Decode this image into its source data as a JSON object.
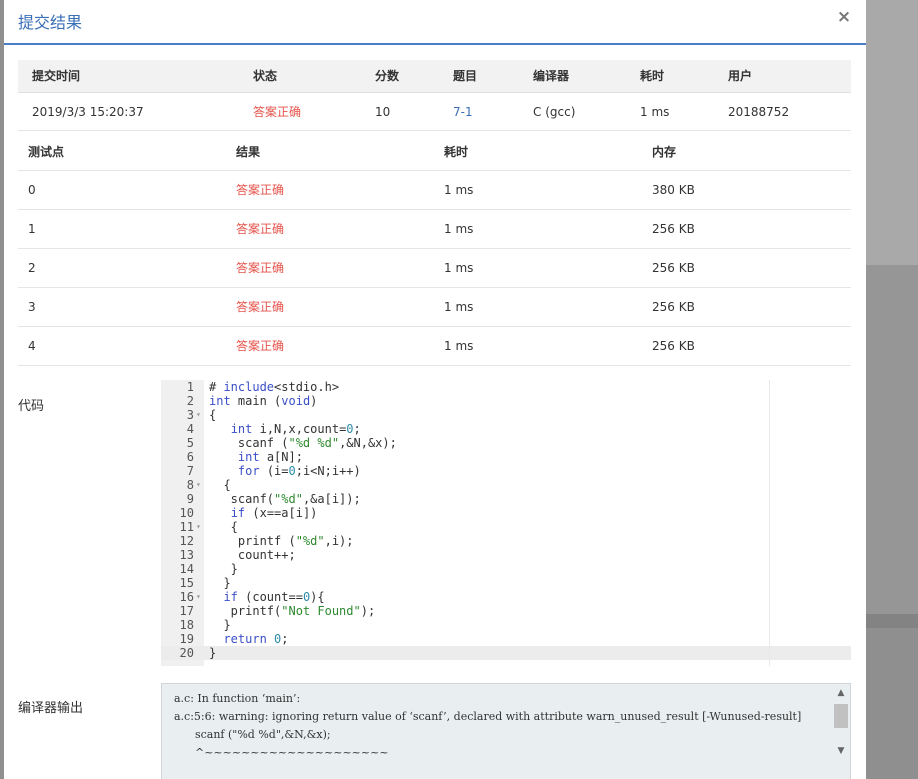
{
  "modal": {
    "title": "提交结果",
    "close_icon": "×"
  },
  "summary": {
    "headers": [
      "提交时间",
      "状态",
      "分数",
      "题目",
      "编译器",
      "耗时",
      "用户"
    ],
    "row": {
      "time": "2019/3/3 15:20:37",
      "status": "答案正确",
      "score": "10",
      "problem": "7-1",
      "compiler": "C (gcc)",
      "elapsed": "1 ms",
      "user": "20188752"
    }
  },
  "tests": {
    "headers": [
      "测试点",
      "结果",
      "耗时",
      "内存"
    ],
    "rows": [
      {
        "id": "0",
        "result": "答案正确",
        "time": "1 ms",
        "memory": "380 KB"
      },
      {
        "id": "1",
        "result": "答案正确",
        "time": "1 ms",
        "memory": "256 KB"
      },
      {
        "id": "2",
        "result": "答案正确",
        "time": "1 ms",
        "memory": "256 KB"
      },
      {
        "id": "3",
        "result": "答案正确",
        "time": "1 ms",
        "memory": "256 KB"
      },
      {
        "id": "4",
        "result": "答案正确",
        "time": "1 ms",
        "memory": "256 KB"
      }
    ]
  },
  "code": {
    "label": "代码",
    "lines": [
      "# include<stdio.h>",
      "int main (void)",
      "{",
      "   int i,N,x,count=0;",
      "    scanf (\"%d %d\",&N,&x);",
      "    int a[N];",
      "    for (i=0;i<N;i++)",
      "  {",
      "   scanf(\"%d\",&a[i]);",
      "   if (x==a[i])",
      "   {",
      "    printf (\"%d\",i);",
      "    count++;",
      "   }",
      "  }",
      "  if (count==0){",
      "   printf(\"Not Found\");",
      "  }",
      "  return 0;",
      "}"
    ],
    "fold_lines": [
      3,
      8,
      11,
      16
    ]
  },
  "compiler_output": {
    "label": "编译器输出",
    "text": "a.c: In function ‘main’:\na.c:5:6: warning: ignoring return value of ‘scanf’, declared with attribute warn_unused_result [-Wunused-result]\n      scanf (\"%d %d\",&N,&x);\n      ^~~~~~~~~~~~~~~~~~~~~"
  },
  "colors": {
    "accent": "#3a6fb6",
    "success": "#e5534b",
    "header_bg": "#f2f2f2"
  }
}
